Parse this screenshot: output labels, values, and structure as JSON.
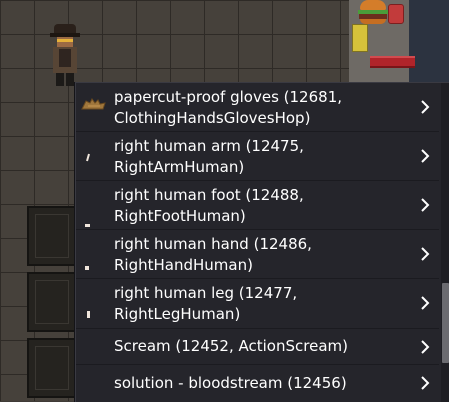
{
  "context_menu": {
    "items": [
      {
        "label_line1": "papercut-proof gloves (12681,",
        "label_line2": "ClothingHandsGlovesHop)",
        "icon": "gloves-icon"
      },
      {
        "label_line1": "right human arm (12475,",
        "label_line2": "RightArmHuman)",
        "icon": "arm-icon"
      },
      {
        "label_line1": "right human foot (12488,",
        "label_line2": "RightFootHuman)",
        "icon": "foot-icon"
      },
      {
        "label_line1": "right human hand (12486,",
        "label_line2": "RightHandHuman)",
        "icon": "hand-icon"
      },
      {
        "label_line1": "right human leg (12477,",
        "label_line2": "RightLegHuman)",
        "icon": "leg-icon"
      },
      {
        "label_line1": "Scream (12452, ActionScream)",
        "label_line2": "",
        "icon": ""
      },
      {
        "label_line1": "solution - bloodstream (12456)",
        "label_line2": "",
        "icon": ""
      }
    ],
    "submenu_icon": "chevron-right-icon",
    "scroll_position": 0.65
  },
  "colors": {
    "menu_background": "#25252b",
    "menu_text": "#ffffff",
    "scrollbar_thumb": "#6b6b70",
    "floor": "#46413b"
  }
}
